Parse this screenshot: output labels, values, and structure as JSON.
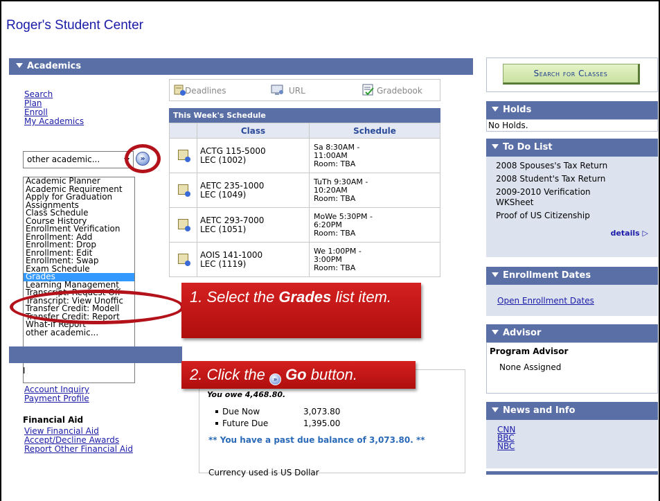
{
  "page_title": "Roger's Student Center",
  "academics": {
    "header": "Academics",
    "links": [
      "Search",
      "Plan",
      "Enroll",
      "My Academics"
    ],
    "select_value": "other academic...",
    "go_label": "»",
    "list_options": [
      "Academic Planner",
      "Academic Requirement",
      "Apply for Graduation",
      "Assignments",
      "Class Schedule",
      "Course History",
      "Enrollment Verification",
      "Enrollment: Add",
      "Enrollment: Drop",
      "Enrollment: Edit",
      "Enrollment: Swap",
      "Exam Schedule",
      "Grades",
      "Learning Management",
      "Transcript: Request Off",
      "Transcript: View Unoffic",
      "Transfer Credit: Modell",
      "Transfer Credit: Report",
      "What-if Report",
      "other academic..."
    ],
    "selected_option": "Grades"
  },
  "toolbar": {
    "deadlines": "Deadlines",
    "url": "URL",
    "gradebook": "Gradebook"
  },
  "schedule": {
    "title": "This Week's Schedule",
    "col_class": "Class",
    "col_schedule": "Schedule",
    "rows": [
      {
        "class_line1": "ACTG 115-5000",
        "class_line2": "LEC (1002)",
        "sched_line1": "Sa 8:30AM -",
        "sched_line2": "11:00AM",
        "sched_line3": "Room:  TBA"
      },
      {
        "class_line1": "AETC 235-1000",
        "class_line2": "LEC (1049)",
        "sched_line1": "TuTh 9:30AM -",
        "sched_line2": "10:20AM",
        "sched_line3": "Room:  TBA"
      },
      {
        "class_line1": "AETC 293-7000",
        "class_line2": "LEC (1051)",
        "sched_line1": "MoWe 5:30PM -",
        "sched_line2": "6:20PM",
        "sched_line3": "Room:  TBA"
      },
      {
        "class_line1": "AOIS 141-1000",
        "class_line2": "LEC (1119)",
        "sched_line1": "We 1:00PM -",
        "sched_line2": "3:00PM",
        "sched_line3": "Room:  TBA"
      }
    ]
  },
  "callouts": {
    "step1_pre": "1. Select the ",
    "step1_bold": "Grades",
    "step1_post": " list item.",
    "step2_pre": "2. Click the ",
    "step2_bold": "Go",
    "step2_post": " button."
  },
  "finances": {
    "partial_letter": "I",
    "links": [
      "Account Inquiry",
      "Payment Profile"
    ],
    "owe_text": "You owe 4,468.80.",
    "due_now_label": "Due Now",
    "due_now_value": "3,073.80",
    "future_due_label": "Future Due",
    "future_due_value": "1,395.00",
    "past_due_msg": "** You have a past due balance of 3,073.80. **",
    "currency": "Currency used is US Dollar",
    "aid_title": "Financial Aid",
    "aid_links": [
      "View Financial Aid",
      "Accept/Decline Awards",
      "Report Other Financial Aid"
    ]
  },
  "right": {
    "search_button": "Search for Classes",
    "holds_title": "Holds",
    "holds_text": "No Holds.",
    "todo_title": "To Do List",
    "todo_items": [
      "2008 Spouses's Tax Return",
      "2008 Student's Tax Return",
      "2009-2010 Verification",
      "WKSheet",
      "Proof of US Citizenship"
    ],
    "todo_details": "details",
    "enroll_title": "Enrollment Dates",
    "enroll_link": "Open Enrollment Dates",
    "advisor_title": "Advisor",
    "advisor_label": "Program Advisor",
    "advisor_value": "None Assigned",
    "news_title": "News and Info",
    "news_links": [
      "CNN",
      "BBC",
      "NBC"
    ]
  },
  "colors": {
    "header_blue": "#5a6fa6",
    "link_blue": "#1a1aa8",
    "callout_red": "#c41616",
    "highlight_ring": "#b3121a"
  }
}
